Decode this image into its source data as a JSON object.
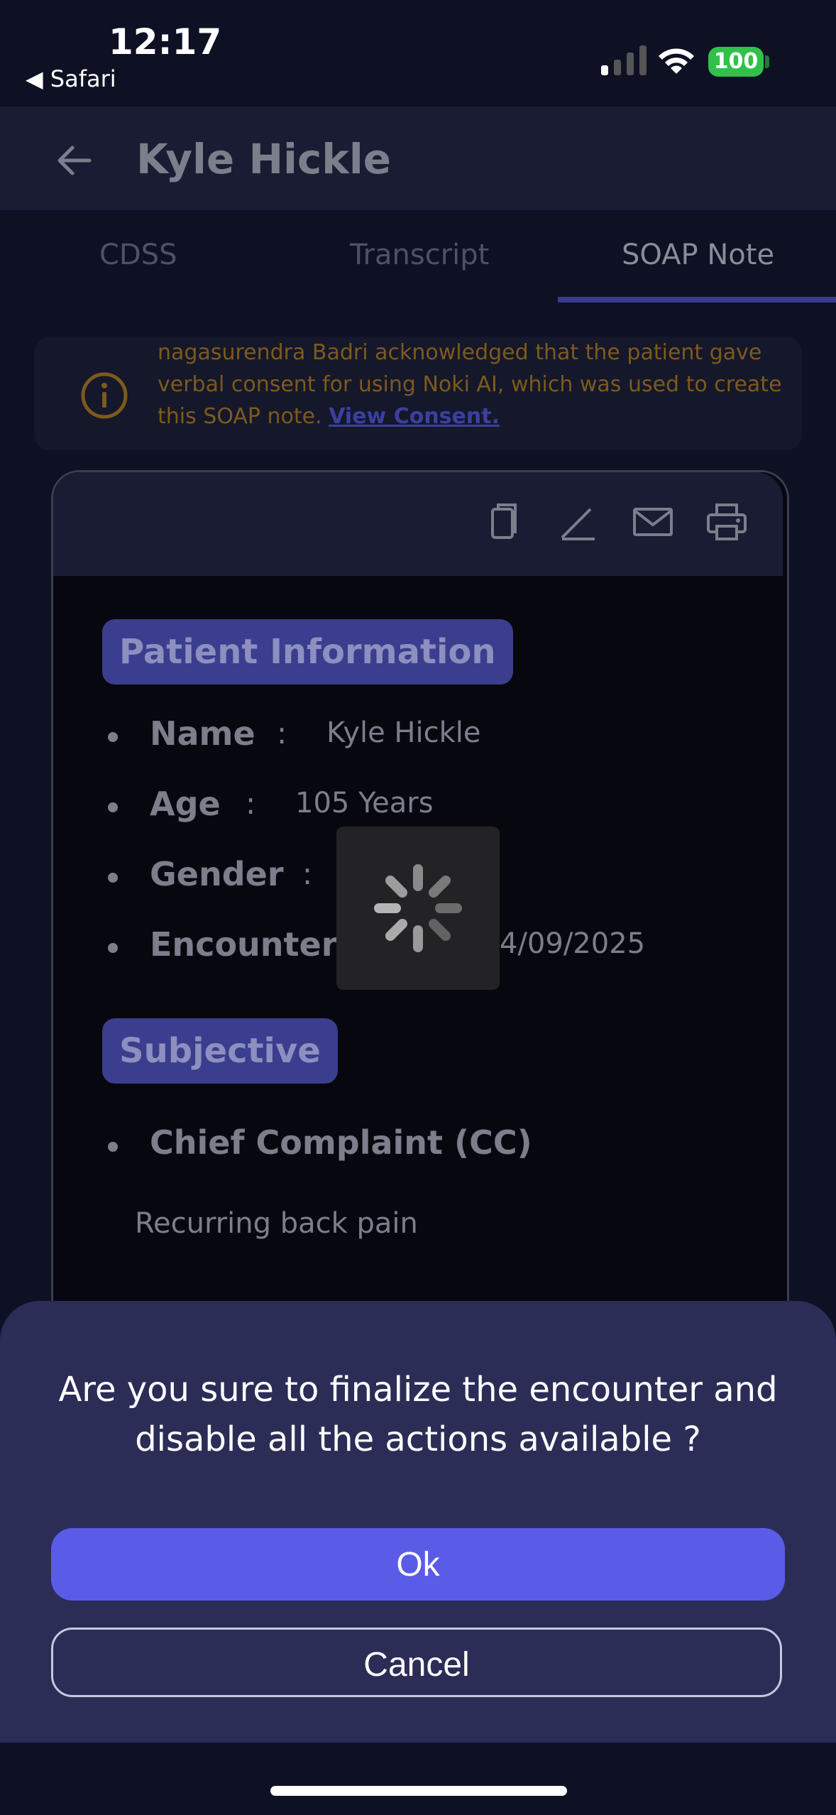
{
  "status_bar": {
    "time": "12:17",
    "back_app": "◀ Safari",
    "battery": "100"
  },
  "header": {
    "title": "Kyle Hickle"
  },
  "tabs": [
    {
      "label": "CDSS"
    },
    {
      "label": "Transcript"
    },
    {
      "label": "SOAP Note"
    }
  ],
  "consent": {
    "text": "nagasurendra Badri acknowledged that the patient gave verbal consent for using Noki AI, which was used to create this SOAP note. ",
    "link": "View Consent."
  },
  "soap": {
    "patient_section": "Patient Information",
    "fields": [
      {
        "label": "Name",
        "colon": ":",
        "value": "Kyle Hickle"
      },
      {
        "label": "Age",
        "colon": ":",
        "value": "105 Years"
      },
      {
        "label": "Gender",
        "colon": ":",
        "value": ""
      },
      {
        "label": "Encounter D",
        "colon": "",
        "value": "4/09/2025"
      }
    ],
    "subjective_section": "Subjective",
    "cc_label": "Chief Complaint (CC)",
    "cc_value": "Recurring back pain"
  },
  "dialog": {
    "message": "Are you sure to finalize the encounter and disable all the actions available ?",
    "ok": "Ok",
    "cancel": "Cancel"
  },
  "colors": {
    "accent": "#5a5ce8",
    "sheet": "#2b2d57",
    "warning": "#7d5a1c"
  }
}
